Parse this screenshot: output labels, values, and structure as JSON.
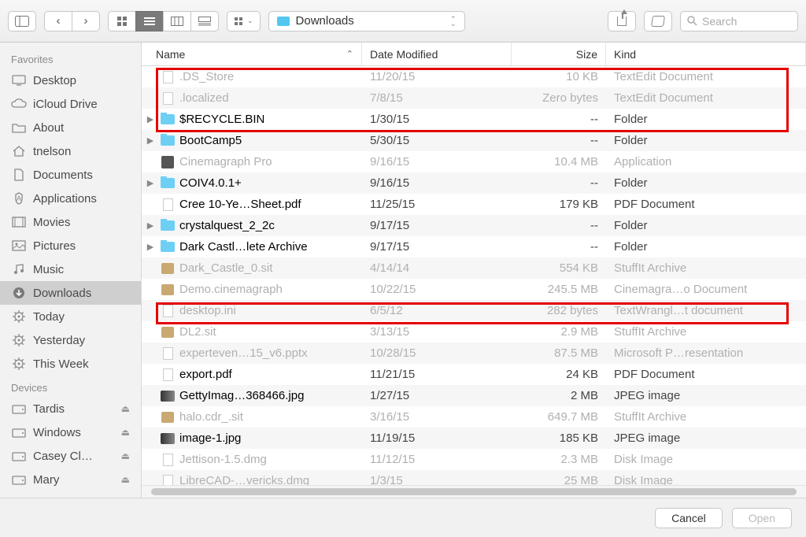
{
  "toolbar": {
    "path_label": "Downloads",
    "search_placeholder": "Search"
  },
  "sidebar": {
    "sections": [
      {
        "header": "Favorites",
        "items": [
          {
            "label": "Desktop",
            "icon": "desktop"
          },
          {
            "label": "iCloud Drive",
            "icon": "cloud"
          },
          {
            "label": "About",
            "icon": "folder"
          },
          {
            "label": "tnelson",
            "icon": "home"
          },
          {
            "label": "Documents",
            "icon": "doc"
          },
          {
            "label": "Applications",
            "icon": "app"
          },
          {
            "label": "Movies",
            "icon": "movie"
          },
          {
            "label": "Pictures",
            "icon": "picture"
          },
          {
            "label": "Music",
            "icon": "music"
          },
          {
            "label": "Downloads",
            "icon": "download",
            "selected": true
          },
          {
            "label": "Today",
            "icon": "gear"
          },
          {
            "label": "Yesterday",
            "icon": "gear"
          },
          {
            "label": "This Week",
            "icon": "gear"
          }
        ]
      },
      {
        "header": "Devices",
        "items": [
          {
            "label": "Tardis",
            "icon": "disk",
            "eject": true
          },
          {
            "label": "Windows",
            "icon": "disk",
            "eject": true
          },
          {
            "label": "Casey Cl…",
            "icon": "disk",
            "eject": true
          },
          {
            "label": "Mary",
            "icon": "disk",
            "eject": true
          }
        ]
      }
    ]
  },
  "columns": {
    "name": "Name",
    "date": "Date Modified",
    "size": "Size",
    "kind": "Kind"
  },
  "rows": [
    {
      "name": ".DS_Store",
      "date": "11/20/15",
      "size": "10 KB",
      "kind": "TextEdit Document",
      "dim": true,
      "expandable": false,
      "icon": "doc"
    },
    {
      "name": ".localized",
      "date": "7/8/15",
      "size": "Zero bytes",
      "kind": "TextEdit Document",
      "dim": true,
      "expandable": false,
      "icon": "doc"
    },
    {
      "name": "$RECYCLE.BIN",
      "date": "1/30/15",
      "size": "--",
      "kind": "Folder",
      "dim": false,
      "expandable": true,
      "icon": "folder"
    },
    {
      "name": "BootCamp5",
      "date": "5/30/15",
      "size": "--",
      "kind": "Folder",
      "dim": false,
      "expandable": true,
      "icon": "folder"
    },
    {
      "name": "Cinemagraph Pro",
      "date": "9/16/15",
      "size": "10.4 MB",
      "kind": "Application",
      "dim": true,
      "expandable": false,
      "icon": "dark"
    },
    {
      "name": "COIV4.0.1+",
      "date": "9/16/15",
      "size": "--",
      "kind": "Folder",
      "dim": false,
      "expandable": true,
      "icon": "folder"
    },
    {
      "name": "Cree 10-Ye…Sheet.pdf",
      "date": "11/25/15",
      "size": "179 KB",
      "kind": "PDF Document",
      "dim": false,
      "expandable": false,
      "icon": "doc"
    },
    {
      "name": "crystalquest_2_2c",
      "date": "9/17/15",
      "size": "--",
      "kind": "Folder",
      "dim": false,
      "expandable": true,
      "icon": "folder"
    },
    {
      "name": "Dark Castl…lete Archive",
      "date": "9/17/15",
      "size": "--",
      "kind": "Folder",
      "dim": false,
      "expandable": true,
      "icon": "folder"
    },
    {
      "name": "Dark_Castle_0.sit",
      "date": "4/14/14",
      "size": "554 KB",
      "kind": "StuffIt Archive",
      "dim": true,
      "expandable": false,
      "icon": "brown"
    },
    {
      "name": "Demo.cinemagraph",
      "date": "10/22/15",
      "size": "245.5 MB",
      "kind": "Cinemagra…o Document",
      "dim": true,
      "expandable": false,
      "icon": "brown"
    },
    {
      "name": "desktop.ini",
      "date": "6/5/12",
      "size": "282 bytes",
      "kind": "TextWrangl…t document",
      "dim": true,
      "expandable": false,
      "icon": "doc"
    },
    {
      "name": "DL2.sit",
      "date": "3/13/15",
      "size": "2.9 MB",
      "kind": "StuffIt Archive",
      "dim": true,
      "expandable": false,
      "icon": "brown"
    },
    {
      "name": "experteven…15_v6.pptx",
      "date": "10/28/15",
      "size": "87.5 MB",
      "kind": "Microsoft P…resentation",
      "dim": true,
      "expandable": false,
      "icon": "doc"
    },
    {
      "name": "export.pdf",
      "date": "11/21/15",
      "size": "24 KB",
      "kind": "PDF Document",
      "dim": false,
      "expandable": false,
      "icon": "doc"
    },
    {
      "name": "GettyImag…368466.jpg",
      "date": "1/27/15",
      "size": "2 MB",
      "kind": "JPEG image",
      "dim": false,
      "expandable": false,
      "icon": "img"
    },
    {
      "name": "halo.cdr_.sit",
      "date": "3/16/15",
      "size": "649.7 MB",
      "kind": "StuffIt Archive",
      "dim": true,
      "expandable": false,
      "icon": "brown"
    },
    {
      "name": "image-1.jpg",
      "date": "11/19/15",
      "size": "185 KB",
      "kind": "JPEG image",
      "dim": false,
      "expandable": false,
      "icon": "img"
    },
    {
      "name": "Jettison-1.5.dmg",
      "date": "11/12/15",
      "size": "2.3 MB",
      "kind": "Disk Image",
      "dim": true,
      "expandable": false,
      "icon": "doc"
    },
    {
      "name": "LibreCAD-…vericks.dmg",
      "date": "1/3/15",
      "size": "25 MB",
      "kind": "Disk Image",
      "dim": true,
      "expandable": false,
      "icon": "doc"
    }
  ],
  "footer": {
    "cancel": "Cancel",
    "open": "Open"
  },
  "highlights": [
    {
      "rows_start": 0,
      "rows_end": 2
    },
    {
      "rows_start": 11,
      "rows_end": 11
    }
  ]
}
